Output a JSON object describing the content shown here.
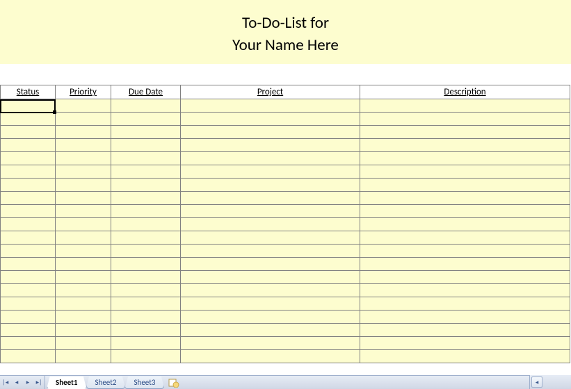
{
  "header": {
    "title_line1": "To-Do-List for",
    "title_line2": "Your Name Here"
  },
  "columns": [
    {
      "key": "status",
      "label": "Status"
    },
    {
      "key": "priority",
      "label": "Priority"
    },
    {
      "key": "duedate",
      "label": "Due Date"
    },
    {
      "key": "project",
      "label": "Project"
    },
    {
      "key": "description",
      "label": "Description"
    }
  ],
  "rows": [
    {
      "status": "",
      "priority": "",
      "duedate": "",
      "project": "",
      "description": ""
    },
    {
      "status": "",
      "priority": "",
      "duedate": "",
      "project": "",
      "description": ""
    },
    {
      "status": "",
      "priority": "",
      "duedate": "",
      "project": "",
      "description": ""
    },
    {
      "status": "",
      "priority": "",
      "duedate": "",
      "project": "",
      "description": ""
    },
    {
      "status": "",
      "priority": "",
      "duedate": "",
      "project": "",
      "description": ""
    },
    {
      "status": "",
      "priority": "",
      "duedate": "",
      "project": "",
      "description": ""
    },
    {
      "status": "",
      "priority": "",
      "duedate": "",
      "project": "",
      "description": ""
    },
    {
      "status": "",
      "priority": "",
      "duedate": "",
      "project": "",
      "description": ""
    },
    {
      "status": "",
      "priority": "",
      "duedate": "",
      "project": "",
      "description": ""
    },
    {
      "status": "",
      "priority": "",
      "duedate": "",
      "project": "",
      "description": ""
    },
    {
      "status": "",
      "priority": "",
      "duedate": "",
      "project": "",
      "description": ""
    },
    {
      "status": "",
      "priority": "",
      "duedate": "",
      "project": "",
      "description": ""
    },
    {
      "status": "",
      "priority": "",
      "duedate": "",
      "project": "",
      "description": ""
    },
    {
      "status": "",
      "priority": "",
      "duedate": "",
      "project": "",
      "description": ""
    },
    {
      "status": "",
      "priority": "",
      "duedate": "",
      "project": "",
      "description": ""
    },
    {
      "status": "",
      "priority": "",
      "duedate": "",
      "project": "",
      "description": ""
    },
    {
      "status": "",
      "priority": "",
      "duedate": "",
      "project": "",
      "description": ""
    },
    {
      "status": "",
      "priority": "",
      "duedate": "",
      "project": "",
      "description": ""
    },
    {
      "status": "",
      "priority": "",
      "duedate": "",
      "project": "",
      "description": ""
    },
    {
      "status": "",
      "priority": "",
      "duedate": "",
      "project": "",
      "description": ""
    }
  ],
  "sheet_tabs": {
    "active_index": 0,
    "tabs": [
      {
        "label": "Sheet1"
      },
      {
        "label": "Sheet2"
      },
      {
        "label": "Sheet3"
      }
    ]
  }
}
